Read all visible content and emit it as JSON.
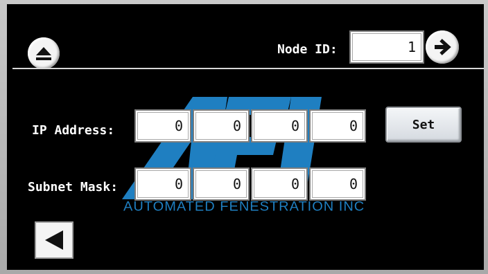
{
  "header": {
    "node_id_label": "Node ID:",
    "node_id_value": "1",
    "eject_icon": "eject-icon",
    "next_icon": "arrow-right-icon"
  },
  "logo": {
    "letters": "AFI",
    "company_name": "AUTOMATED FENESTRATION INC",
    "brand_color": "#1f7fc1"
  },
  "network": {
    "ip_label": "IP Address:",
    "ip_octets": [
      "0",
      "0",
      "0",
      "0"
    ],
    "subnet_label": "Subnet Mask:",
    "subnet_octets": [
      "0",
      "0",
      "0",
      "0"
    ],
    "set_label": "Set"
  },
  "footer": {
    "back_icon": "back-triangle-icon"
  }
}
